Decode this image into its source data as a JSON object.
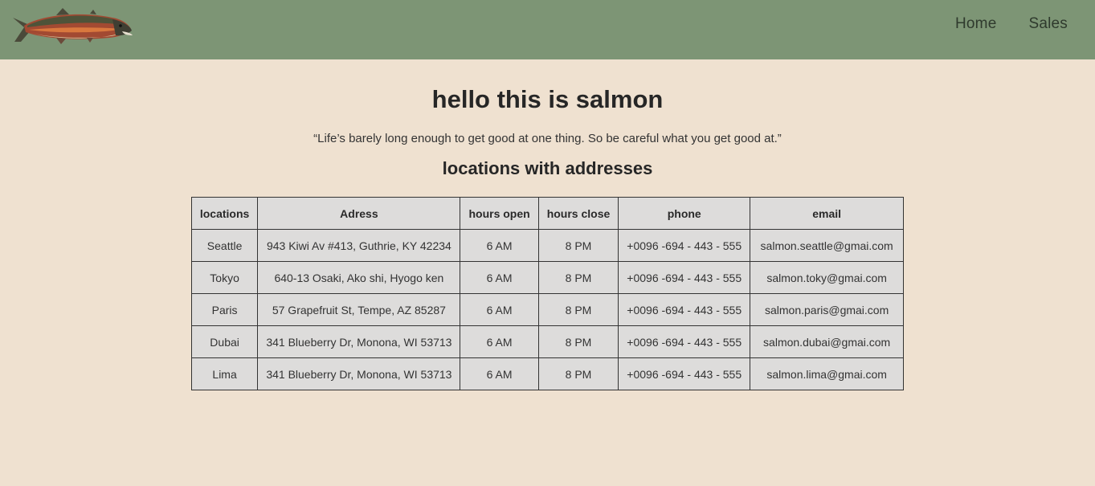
{
  "header": {
    "logo_alt": "salmon",
    "nav": [
      "Home",
      "Sales"
    ]
  },
  "main": {
    "title": "hello this is salmon",
    "quote": "“Life’s barely long enough to get good at one thing. So be careful what you get good at.”",
    "subtitle": "locations with addresses"
  },
  "table": {
    "headers": [
      "locations",
      "Adress",
      "hours open",
      "hours close",
      "phone",
      "email"
    ],
    "rows": [
      [
        "Seattle",
        "943 Kiwi Av #413, Guthrie, KY 42234",
        "6 AM",
        "8 PM",
        "+0096 -694 - 443 - 555",
        "salmon.seattle@gmai.com"
      ],
      [
        "Tokyo",
        "640-13 Osaki, Ako shi, Hyogo ken",
        "6 AM",
        "8 PM",
        "+0096 -694 - 443 - 555",
        "salmon.toky@gmai.com"
      ],
      [
        "Paris",
        "57 Grapefruit St, Tempe, AZ 85287",
        "6 AM",
        "8 PM",
        "+0096 -694 - 443 - 555",
        "salmon.paris@gmai.com"
      ],
      [
        "Dubai",
        "341 Blueberry Dr, Monona, WI 53713",
        "6 AM",
        "8 PM",
        "+0096 -694 - 443 - 555",
        "salmon.dubai@gmai.com"
      ],
      [
        "Lima",
        "341 Blueberry Dr, Monona, WI 53713",
        "6 AM",
        "8 PM",
        "+0096 -694 - 443 - 555",
        "salmon.lima@gmai.com"
      ]
    ]
  },
  "colors": {
    "header_bg": "#7d9575",
    "page_bg": "#efe1d0",
    "table_bg": "#dddcdb"
  }
}
